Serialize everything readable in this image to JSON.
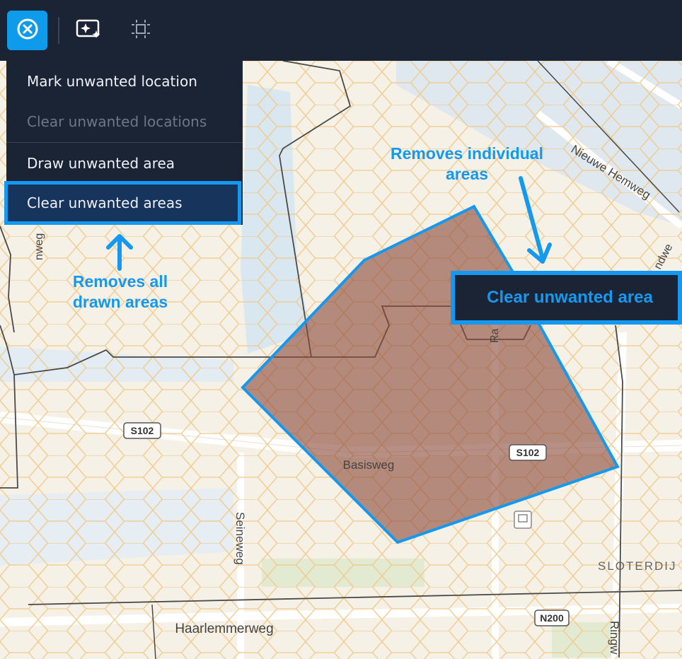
{
  "toolbar": {
    "buttons": [
      {
        "icon": "close-circle-icon",
        "state": "active"
      },
      {
        "icon": "ai-image-icon"
      },
      {
        "icon": "select-frame-icon"
      }
    ]
  },
  "menu": {
    "items": [
      {
        "label": "Mark unwanted location",
        "enabled": true
      },
      {
        "label": "Clear unwanted locations",
        "enabled": false
      },
      {
        "label": "Draw unwanted area",
        "enabled": true
      },
      {
        "label": "Clear unwanted areas",
        "enabled": true,
        "highlighted": true
      }
    ]
  },
  "annotations": {
    "removes_all": [
      "Removes all",
      "drawn areas"
    ],
    "removes_individual": [
      "Removes individual",
      "areas"
    ]
  },
  "context_button": {
    "label": "Clear unwanted area"
  },
  "map": {
    "labels": {
      "street_basisweg": "Basisweg",
      "street_seineweg": "Seineweg",
      "street_haarlemmerweg": "Haarlemmerweg",
      "street_nieuwe_hemweg": "Nieuwe Hemweg",
      "street_ringweg": "Ringw",
      "street_left_weg": "nweg",
      "street_right_top": "ndwe",
      "street_ra": "Ra",
      "district_sloterdijk": "SLOTERDIJ",
      "road_s102_left": "S102",
      "road_s102_right": "S102",
      "road_n200": "N200"
    }
  },
  "colors": {
    "toolbar_bg": "#1b2434",
    "accent": "#1599f0",
    "polygon_fill": "#8b4a3a",
    "hex_stroke": "#f0c98a"
  }
}
